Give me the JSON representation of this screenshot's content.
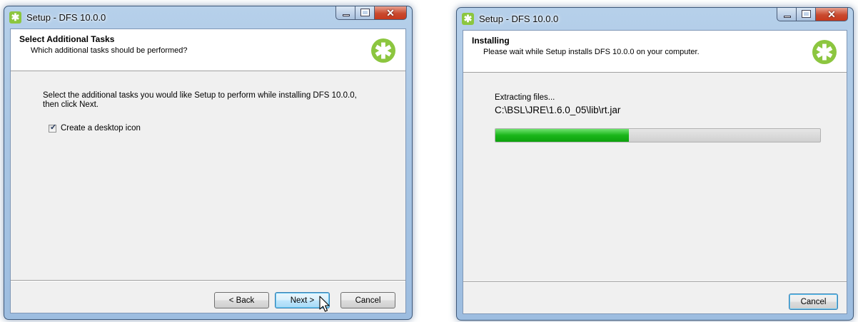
{
  "app_icon": "setup-app-icon",
  "logo_icon": "green-asterisk-logo",
  "colors": {
    "accent": "#8cc63f",
    "progress_fill": "#19b619",
    "titlebar": "#a9c6e4",
    "close_button": "#c7391d"
  },
  "window1": {
    "title": "Setup - DFS 10.0.0",
    "header": {
      "title": "Select Additional Tasks",
      "subtitle": "Which additional tasks should be performed?"
    },
    "instruction_line1": "Select the additional tasks you would like Setup to perform while installing DFS 10.0.0,",
    "instruction_line2": "then click Next.",
    "tasks": [
      {
        "label": "Create a desktop icon",
        "checked": true
      }
    ],
    "buttons": {
      "back": "< Back",
      "next": "Next >",
      "cancel": "Cancel"
    }
  },
  "window2": {
    "title": "Setup - DFS 10.0.0",
    "header": {
      "title": "Installing",
      "subtitle": "Please wait while Setup installs DFS 10.0.0 on your computer."
    },
    "status": "Extracting files...",
    "current_file": "C:\\BSL\\JRE\\1.6.0_05\\lib\\rt.jar",
    "progress": 0.41,
    "buttons": {
      "cancel": "Cancel"
    }
  }
}
